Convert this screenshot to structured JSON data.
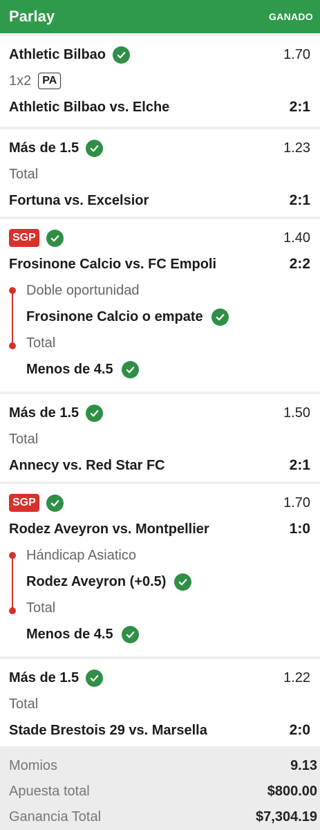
{
  "header": {
    "title": "Parlay",
    "status": "GANADO"
  },
  "legs": [
    {
      "pick": "Athletic Bilbao",
      "odds": "1.70",
      "market": "1x2",
      "badge": "PA",
      "event": "Athletic Bilbao vs. Elche",
      "score": "2:1"
    },
    {
      "pick": "Más de 1.5",
      "odds": "1.23",
      "market": "Total",
      "event": "Fortuna vs. Excelsior",
      "score": "2:1"
    },
    {
      "badge": "SGP",
      "odds": "1.40",
      "event": "Frosinone Calcio vs. FC Empoli",
      "score": "2:2",
      "selections": [
        {
          "market": "Doble oportunidad",
          "pick": "Frosinone Calcio o empate"
        },
        {
          "market": "Total",
          "pick": "Menos de 4.5"
        }
      ]
    },
    {
      "pick": "Más de 1.5",
      "odds": "1.50",
      "market": "Total",
      "event": "Annecy vs. Red Star FC",
      "score": "2:1"
    },
    {
      "badge": "SGP",
      "odds": "1.70",
      "event": "Rodez Aveyron vs. Montpellier",
      "score": "1:0",
      "selections": [
        {
          "market": "Hándicap Asiatico",
          "pick": "Rodez Aveyron (+0.5)"
        },
        {
          "market": "Total",
          "pick": "Menos de 4.5"
        }
      ]
    },
    {
      "pick": "Más de 1.5",
      "odds": "1.22",
      "market": "Total",
      "event": "Stade Brestois 29 vs. Marsella",
      "score": "2:0"
    }
  ],
  "summary": {
    "momios_label": "Momios",
    "momios_value": "9.13",
    "stake_label": "Apuesta total",
    "stake_value": "$800.00",
    "win_label": "Ganancia Total",
    "win_value": "$7,304.19"
  },
  "icons": {
    "check": "check-circle-icon"
  },
  "colors": {
    "header_bg": "#2f9a4b",
    "check_bg": "#2f8f46",
    "sgp_bg": "#dc2f2b"
  }
}
